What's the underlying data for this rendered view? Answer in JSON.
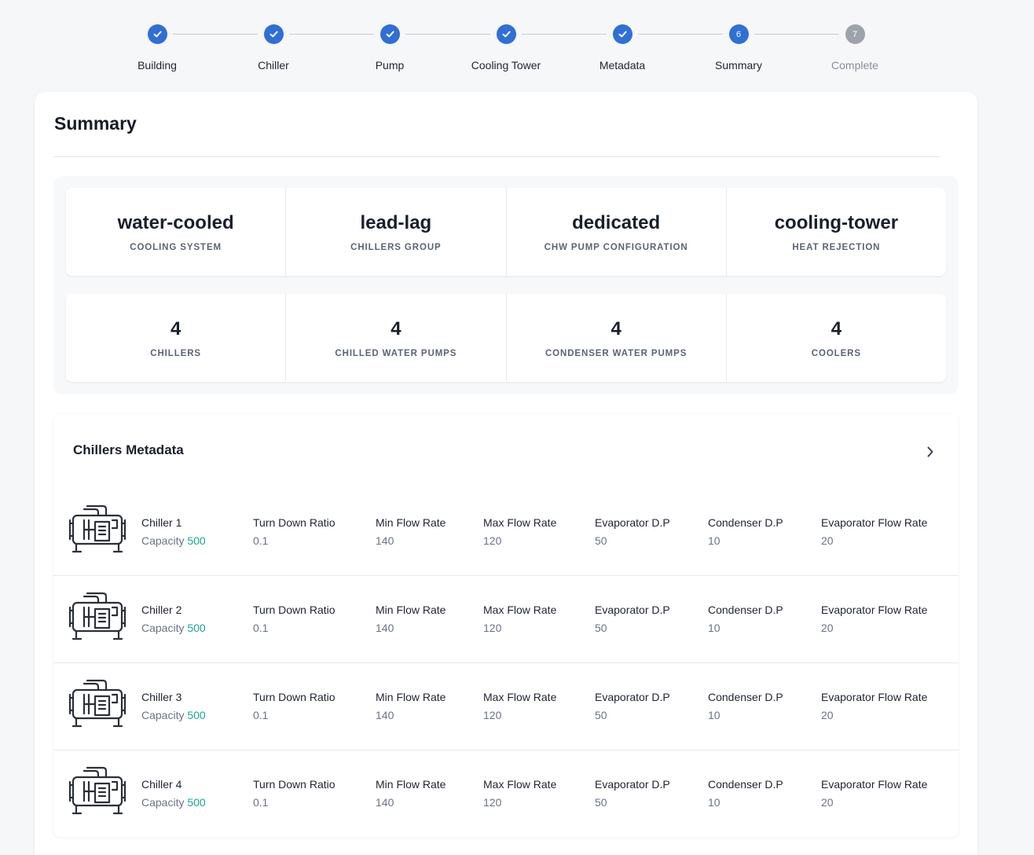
{
  "stepper": {
    "steps": [
      {
        "label": "Building",
        "state": "done",
        "number": "1"
      },
      {
        "label": "Chiller",
        "state": "done",
        "number": "2"
      },
      {
        "label": "Pump",
        "state": "done",
        "number": "3"
      },
      {
        "label": "Cooling Tower",
        "state": "done",
        "number": "4"
      },
      {
        "label": "Metadata",
        "state": "done",
        "number": "5"
      },
      {
        "label": "Summary",
        "state": "active",
        "number": "6"
      },
      {
        "label": "Complete",
        "state": "pending",
        "number": "7"
      }
    ],
    "colors": {
      "active": "#2f6fd6",
      "pending": "#9ea3ab"
    }
  },
  "summary": {
    "title": "Summary",
    "config": [
      {
        "value": "water-cooled",
        "label": "COOLING SYSTEM"
      },
      {
        "value": "lead-lag",
        "label": "CHILLERS GROUP"
      },
      {
        "value": "dedicated",
        "label": "CHW PUMP CONFIGURATION"
      },
      {
        "value": "cooling-tower",
        "label": "HEAT REJECTION"
      }
    ],
    "counts": [
      {
        "value": "4",
        "label": "CHILLERS"
      },
      {
        "value": "4",
        "label": "CHILLED WATER PUMPS"
      },
      {
        "value": "4",
        "label": "CONDENSER WATER PUMPS"
      },
      {
        "value": "4",
        "label": "COOLERS"
      }
    ]
  },
  "chillers_metadata": {
    "title": "Chillers Metadata",
    "expand_icon": "chevron-right-icon",
    "capacity_label": "Capacity",
    "capacity_color": "#17a79a",
    "field_labels": [
      "Turn Down Ratio",
      "Min Flow Rate",
      "Max Flow Rate",
      "Evaporator D.P",
      "Condenser D.P",
      "Evaporator Flow Rate"
    ],
    "rows": [
      {
        "name": "Chiller 1",
        "capacity": "500",
        "fields": [
          "0.1",
          "140",
          "120",
          "50",
          "10",
          "20"
        ]
      },
      {
        "name": "Chiller 2",
        "capacity": "500",
        "fields": [
          "0.1",
          "140",
          "120",
          "50",
          "10",
          "20"
        ]
      },
      {
        "name": "Chiller 3",
        "capacity": "500",
        "fields": [
          "0.1",
          "140",
          "120",
          "50",
          "10",
          "20"
        ]
      },
      {
        "name": "Chiller 4",
        "capacity": "500",
        "fields": [
          "0.1",
          "140",
          "120",
          "50",
          "10",
          "20"
        ]
      }
    ]
  }
}
